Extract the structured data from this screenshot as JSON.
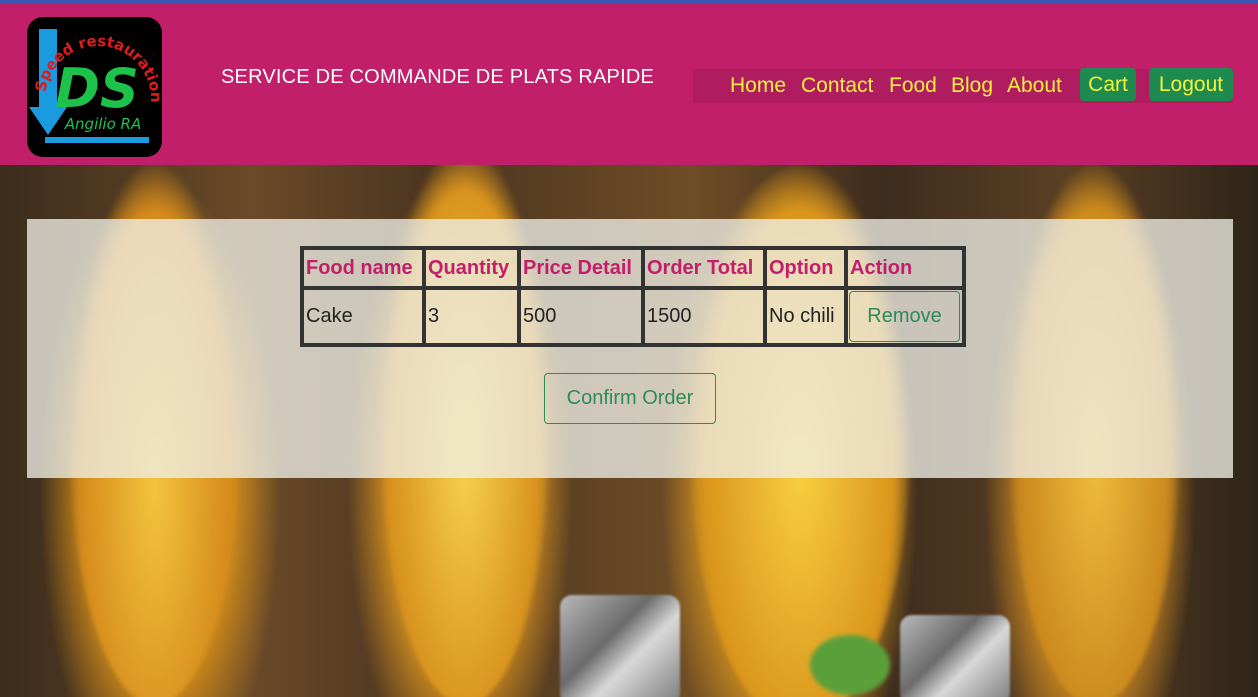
{
  "header": {
    "logo": {
      "main_text": "DS",
      "arc_text": "Speed restauration",
      "sub_text": "Angilio RA",
      "colors": {
        "background": "#000000",
        "main": "#1cc24a",
        "arc": "#e01b1b",
        "arrow": "#1a9be0"
      }
    },
    "site_title": "SERVICE DE COMMANDE DE PLATS RAPIDE",
    "nav": {
      "links": [
        "Home",
        "Contact",
        "Food",
        "Blog",
        "About"
      ],
      "cart_label": "Cart",
      "logout_label": "Logout"
    },
    "colors": {
      "header_bg": "#c11f6a",
      "nav_text": "#f2f23a",
      "nav_button_bg": "#1e8a4f"
    }
  },
  "cart": {
    "columns": [
      "Food name",
      "Quantity",
      "Price Detail",
      "Order Total",
      "Option",
      "Action"
    ],
    "rows": [
      {
        "food_name": "Cake",
        "quantity": "3",
        "price_detail": "500",
        "order_total": "1500",
        "option": "No chili",
        "action_label": "Remove"
      }
    ],
    "confirm_label": "Confirm Order",
    "colors": {
      "header_text": "#c11f6a",
      "button": "#2e8a57"
    }
  }
}
